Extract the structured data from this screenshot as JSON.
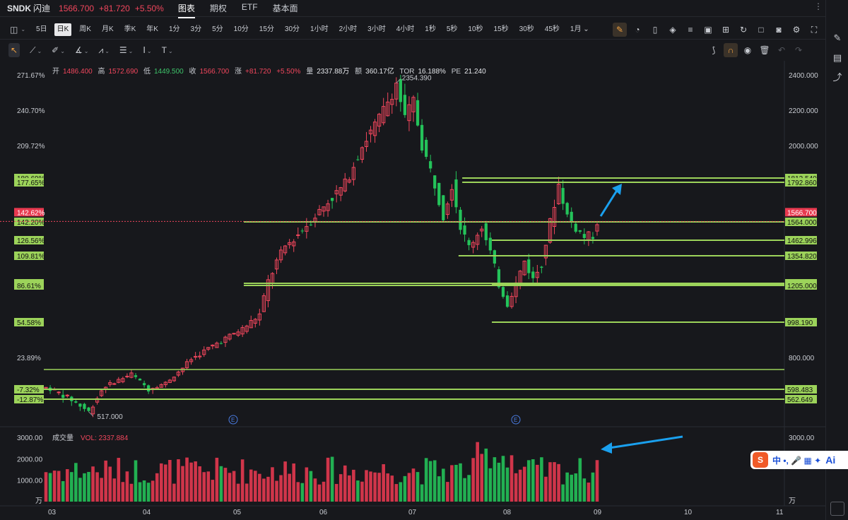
{
  "header": {
    "symbol": "SNDK",
    "name": "闪迪",
    "price": "1566.700",
    "change": "+81.720",
    "change_pct": "+5.50%",
    "tabs": [
      "图表",
      "期权",
      "ETF",
      "基本面"
    ],
    "active_tab": 0
  },
  "toolbar": {
    "intervals": [
      "5日",
      "日K",
      "周K",
      "月K",
      "季K",
      "年K",
      "1分",
      "3分",
      "5分",
      "10分",
      "15分",
      "30分",
      "1小时",
      "2小时",
      "3小时",
      "4小时",
      "1秒",
      "5秒",
      "10秒",
      "15秒",
      "30秒",
      "45秒",
      "1月"
    ],
    "active_interval": 1
  },
  "ohlc": {
    "open_label": "开",
    "open": "1486.400",
    "high_label": "高",
    "high": "1572.690",
    "low_label": "低",
    "low": "1449.500",
    "close_label": "收",
    "close": "1566.700",
    "chg_label": "涨",
    "chg": "+81.720",
    "chg_pct": "+5.50%",
    "vol_label": "量",
    "vol": "2337.88万",
    "amt_label": "额",
    "amt": "360.17亿",
    "tor_label": "TOR",
    "tor": "16.188%",
    "pe_label": "PE",
    "pe": "21.240"
  },
  "volume": {
    "label": "成交量",
    "vol_text": "VOL: 2337.884",
    "unit": "万"
  },
  "ime": {
    "logo": "S",
    "text": "中 •, 🎤 ▦ ✦",
    "ai": "Ai"
  },
  "colors": {
    "up": "#f0465c",
    "down": "#24c35a",
    "line": "#9cd35a",
    "bg": "#17181c",
    "arrow": "#1aa0ee"
  },
  "chart_data": {
    "type": "candlestick",
    "price_axis": {
      "ylim": [
        720,
        2420
      ],
      "ticks": [
        2400,
        2200,
        2000,
        800
      ],
      "tick_labels": [
        "2400.000",
        "2200.000",
        "2000.000",
        "800.000"
      ]
    },
    "pct_axis": {
      "labels": [
        "271.67%",
        "240.70%",
        "209.72%",
        "23.89%"
      ],
      "values": [
        2400,
        2200,
        2000,
        800
      ]
    },
    "x_labels": [
      "03",
      "04",
      "05",
      "06",
      "07",
      "08",
      "09",
      "10",
      "11"
    ],
    "annotations": {
      "high": "2354.390",
      "low": "517.000"
    },
    "levels": [
      {
        "price": "1812.540",
        "pct": "180.69%",
        "start": 0.565
      },
      {
        "price": "1792.860",
        "pct": "177.65%",
        "start": 0.565
      },
      {
        "price": "1564.000",
        "pct": "142.20%",
        "start": 0.27
      },
      {
        "price": "1462.996",
        "pct": "126.56%",
        "start": 0.605
      },
      {
        "price": "1354.820",
        "pct": "109.81%",
        "start": 0.56
      },
      {
        "price": "1222.180",
        "pct": "89.27%",
        "start": 0.27
      },
      {
        "price": "1213.680",
        "pct": "87.95%",
        "start": 0.605
      },
      {
        "price": "1205.000",
        "pct": "86.61%",
        "start": 0.27
      },
      {
        "price": "998.190",
        "pct": "54.58%",
        "start": 0.605
      },
      {
        "price": "598.483",
        "pct": "-7.32%",
        "start": 0.0
      },
      {
        "price": "562.649",
        "pct": "-12.87%",
        "start": 0.0
      }
    ],
    "plain_lines": [
      730
    ],
    "last_price": {
      "price": "1566.700",
      "pct": "142.62%"
    },
    "volume_axis": {
      "ticks": [
        3000,
        2000,
        1000
      ],
      "tick_labels": [
        "3000.00",
        "2000.00",
        "1000.00"
      ]
    }
  }
}
